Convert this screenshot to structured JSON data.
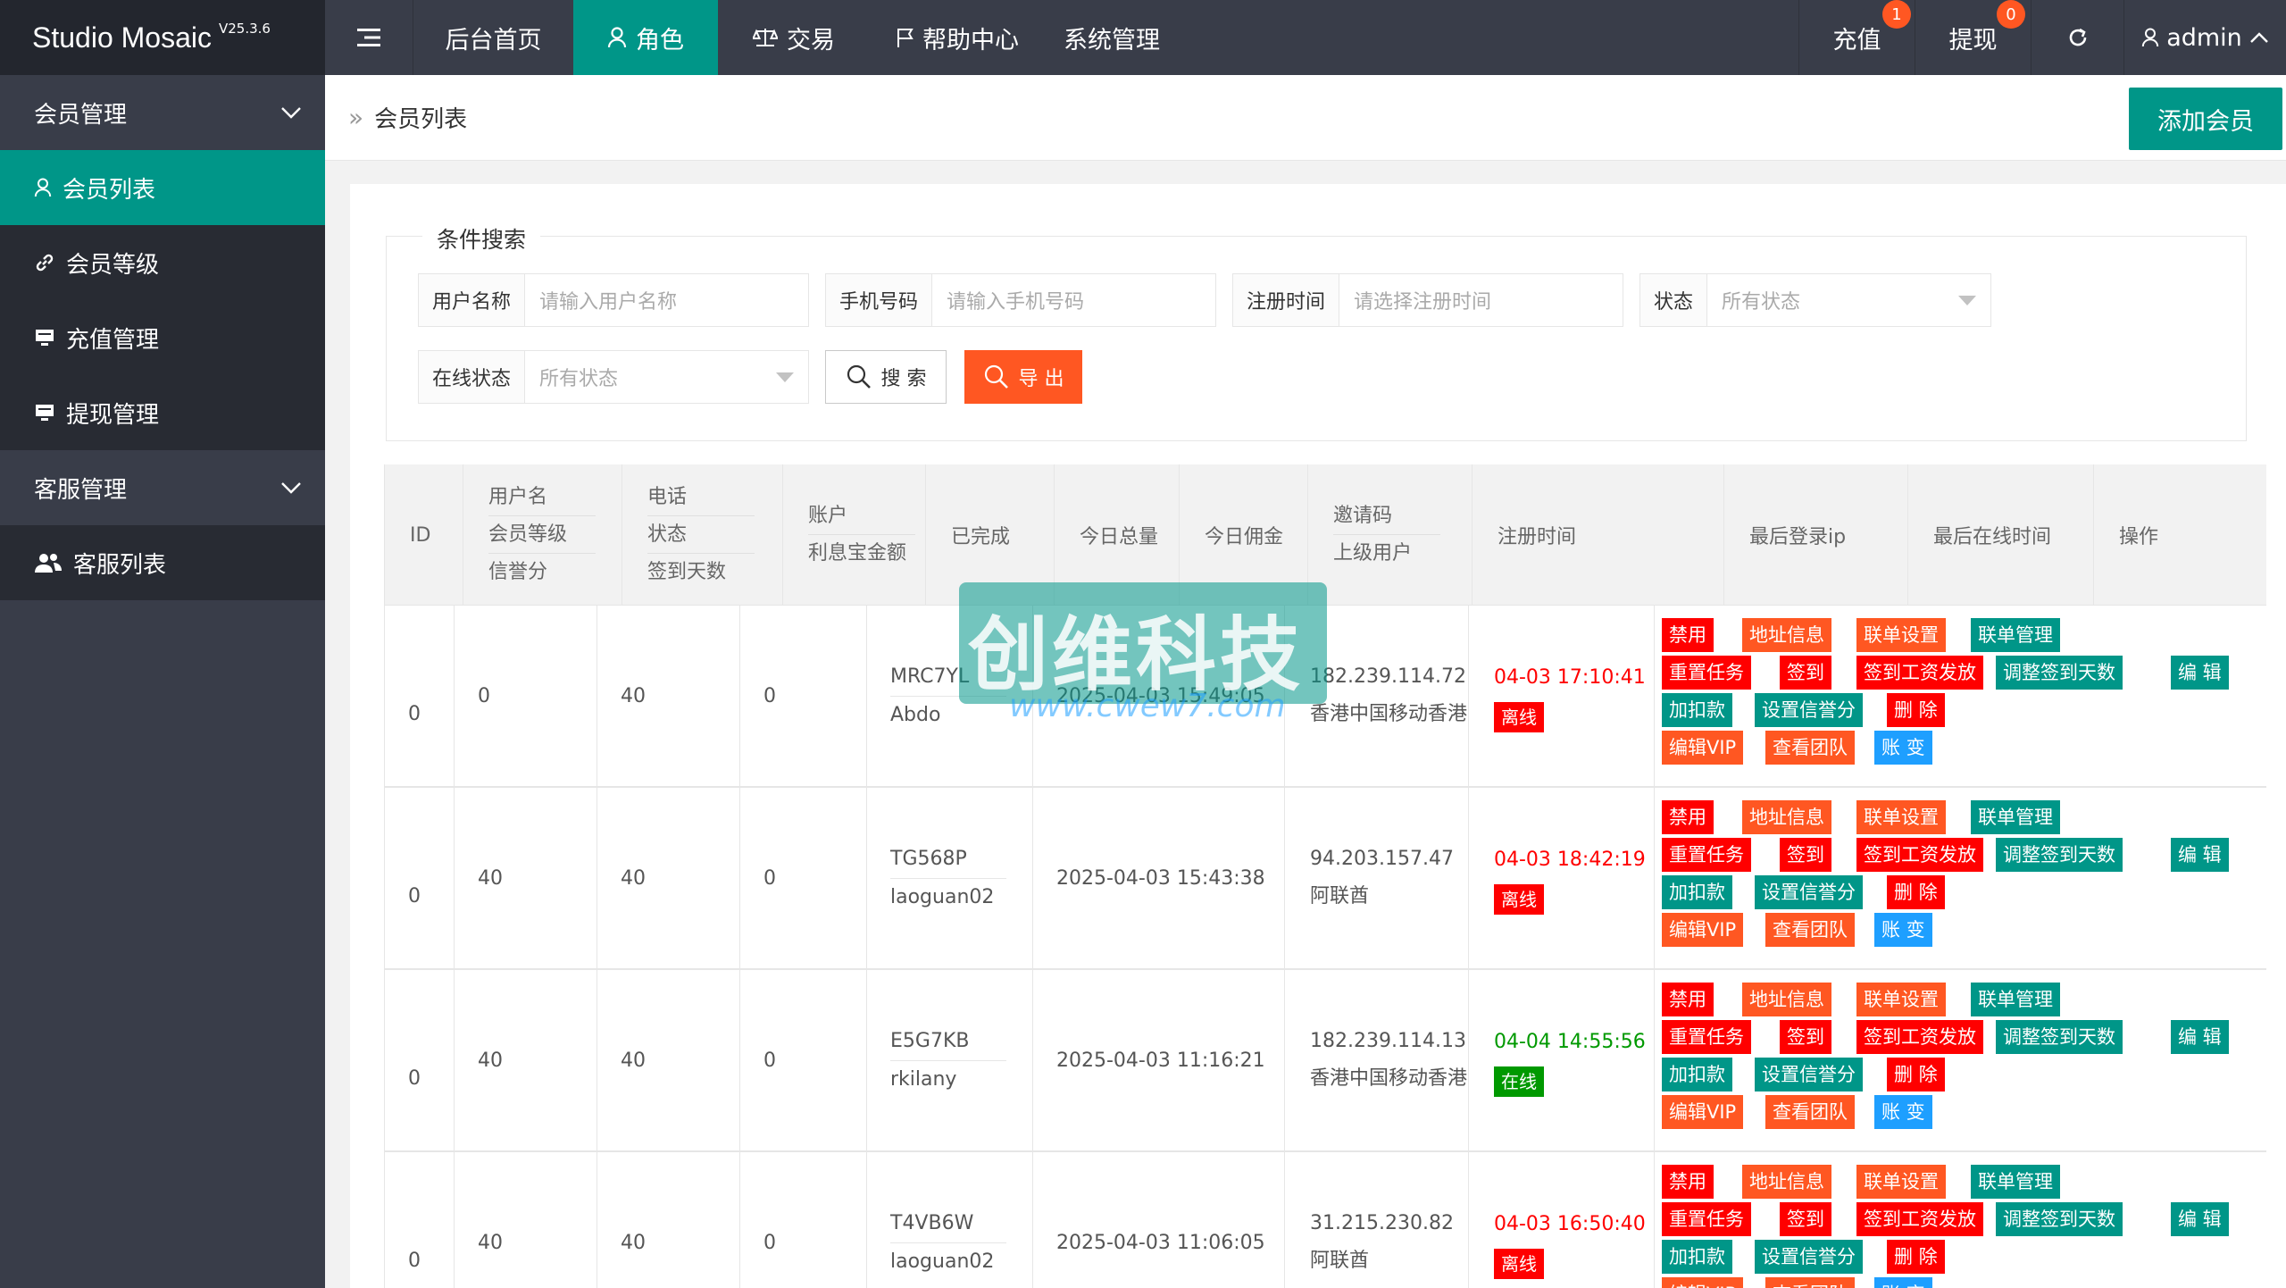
{
  "brand": {
    "name": "Studio Mosaic",
    "version": "V25.3.6"
  },
  "topnav": {
    "menu_icon": "hamburger-icon",
    "items": [
      {
        "label": "后台首页",
        "icon": ""
      },
      {
        "label": "角色",
        "icon": "user-icon",
        "active": true
      },
      {
        "label": "交易",
        "icon": "scale-icon"
      },
      {
        "label": "帮助中心",
        "icon": "flag-icon"
      },
      {
        "label": "系统管理",
        "icon": ""
      }
    ],
    "right": [
      {
        "label": "充值",
        "badge": "1"
      },
      {
        "label": "提现",
        "badge": "0"
      }
    ],
    "refresh_icon": "refresh-icon",
    "user": "admin"
  },
  "sidebar": {
    "groups": [
      {
        "label": "会员管理",
        "items": [
          {
            "label": "会员列表",
            "icon": "user-icon",
            "active": true
          },
          {
            "label": "会员等级",
            "icon": "link-icon"
          },
          {
            "label": "充值管理",
            "icon": "monitor-icon"
          },
          {
            "label": "提现管理",
            "icon": "monitor-icon"
          }
        ]
      },
      {
        "label": "客服管理",
        "items": [
          {
            "label": "客服列表",
            "icon": "users-icon"
          }
        ]
      }
    ]
  },
  "breadcrumb": {
    "current": "会员列表"
  },
  "add_button": "添加会员",
  "search": {
    "legend": "条件搜索",
    "fields": [
      {
        "label": "用户名称",
        "placeholder": "请输入用户名称"
      },
      {
        "label": "手机号码",
        "placeholder": "请输入手机号码"
      },
      {
        "label": "注册时间",
        "placeholder": "请选择注册时间"
      },
      {
        "label": "状态",
        "placeholder": "所有状态"
      },
      {
        "label": "在线状态",
        "placeholder": "所有状态"
      }
    ],
    "search_btn": "搜 索",
    "export_btn": "导 出"
  },
  "table": {
    "headers": {
      "id": "ID",
      "user": [
        "用户名",
        "会员等级",
        "信誉分"
      ],
      "phone": [
        "电话",
        "状态",
        "签到天数"
      ],
      "account": [
        "账户",
        "利息宝金额"
      ],
      "done": "已完成",
      "today_total": "今日总量",
      "today_comm": "今日佣金",
      "invite": [
        "邀请码",
        "上级用户"
      ],
      "regtime": "注册时间",
      "lastip": "最后登录ip",
      "lastonline": "最后在线时间",
      "ops": "操作"
    },
    "rows": [
      {
        "id": "0",
        "done": "0",
        "today_total": "40",
        "today_comm": "0",
        "invite": "MRC7YL",
        "parent": "Abdo",
        "regtime": "2025-04-03 15:49:05",
        "ip": "182.239.114.72",
        "location": "香港中国移动香港",
        "online_time": "04-03 17:10:41",
        "online": "离线",
        "is_online": false
      },
      {
        "id": "0",
        "done": "40",
        "today_total": "40",
        "today_comm": "0",
        "invite": "TG568P",
        "parent": "laoguan02",
        "regtime": "2025-04-03 15:43:38",
        "ip": "94.203.157.47",
        "location": "阿联酋",
        "online_time": "04-03 18:42:19",
        "online": "离线",
        "is_online": false
      },
      {
        "id": "0",
        "done": "40",
        "today_total": "40",
        "today_comm": "0",
        "invite": "E5G7KB",
        "parent": "rkilany",
        "regtime": "2025-04-03 11:16:21",
        "ip": "182.239.114.13",
        "location": "香港中国移动香港",
        "online_time": "04-04 14:55:56",
        "online": "在线",
        "is_online": true
      },
      {
        "id": "0",
        "done": "40",
        "today_total": "40",
        "today_comm": "0",
        "invite": "T4VB6W",
        "parent": "laoguan02",
        "regtime": "2025-04-03 11:06:05",
        "ip": "31.215.230.82",
        "location": "阿联酋",
        "online_time": "04-03 16:50:40",
        "online": "离线",
        "is_online": false
      }
    ],
    "actions": [
      "禁用",
      "地址信息",
      "联单设置",
      "联单管理",
      "重置任务",
      "签到",
      "签到工资发放",
      "调整签到天数",
      "编 辑",
      "加扣款",
      "设置信誉分",
      "删 除",
      "编辑VIP",
      "查看团队",
      "账 变"
    ]
  },
  "watermark": {
    "title": "创维科技",
    "url": "www.cwew7.com"
  }
}
